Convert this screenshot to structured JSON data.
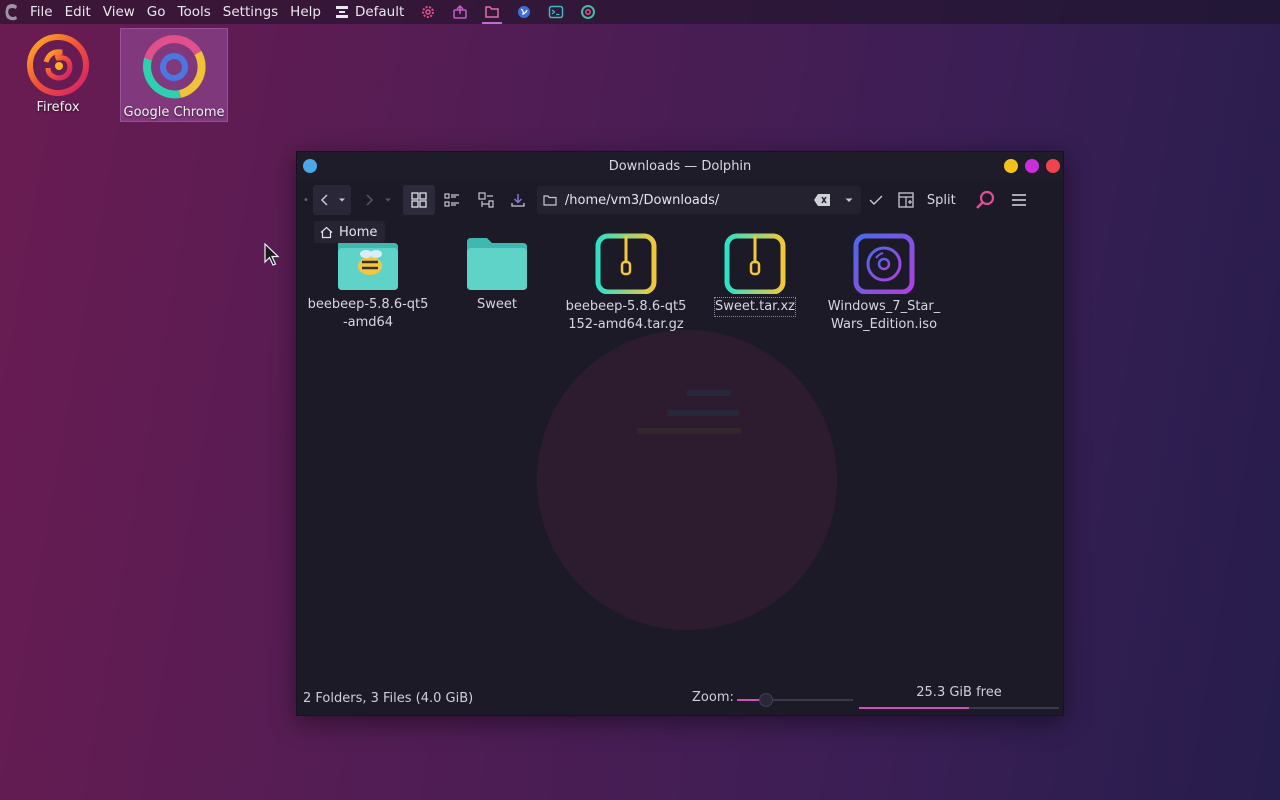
{
  "top_panel": {
    "menu": [
      "File",
      "Edit",
      "View",
      "Go",
      "Tools",
      "Settings",
      "Help"
    ],
    "layout_label": "Default",
    "tray_icons": [
      "settings-icon",
      "share-icon",
      "folder-icon",
      "browser-icon",
      "terminal-icon",
      "chrome-icon"
    ]
  },
  "desktop": {
    "icons": [
      {
        "label": "Firefox",
        "icon": "firefox-icon",
        "selected": false
      },
      {
        "label": "Google Chrome",
        "icon": "chrome-icon",
        "selected": true
      }
    ]
  },
  "window": {
    "title": "Downloads — Dolphin",
    "location_path": "/home/vm3/Downloads/",
    "split_label": "Split",
    "tooltip": "Home",
    "files": [
      {
        "name": "beebeep-5.8.6-qt5-amd64",
        "type": "folder",
        "icon": "beebeep-folder-icon"
      },
      {
        "name": "Sweet",
        "type": "folder",
        "icon": "folder-icon"
      },
      {
        "name": "beebeep-5.8.6-qt5152-amd64.tar.gz",
        "type": "archive",
        "icon": "archive-icon"
      },
      {
        "name": "Sweet.tar.xz",
        "type": "archive",
        "icon": "archive-icon",
        "focused": true
      },
      {
        "name": "Windows_7_Star_Wars_Edition.iso",
        "type": "disk-image",
        "icon": "disc-image-icon"
      }
    ],
    "status": {
      "summary": "2 Folders, 3 Files (4.0 GiB)",
      "zoom_label": "Zoom:",
      "zoom_level": 0.25,
      "free_space": "25.3 GiB free",
      "disk_used_fraction": 0.55
    }
  },
  "colors": {
    "accent": "#d04fb8",
    "folder": "#5fd3c8",
    "window_bg": "#1c1a27"
  }
}
